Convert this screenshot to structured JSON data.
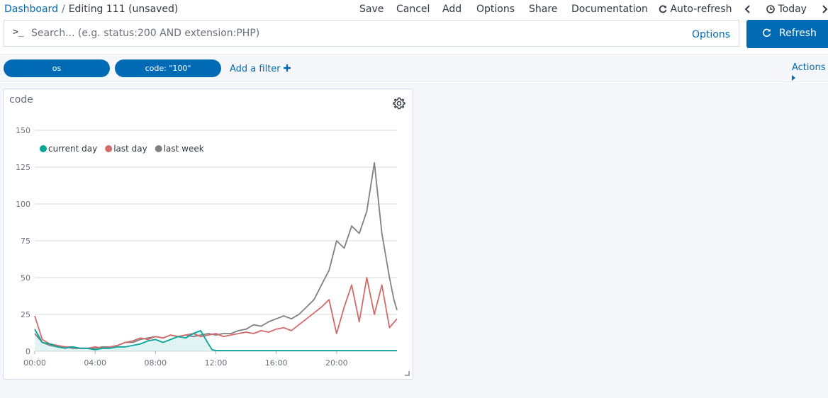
{
  "breadcrumb": {
    "root": "Dashboard",
    "separator": "/",
    "current": "Editing 111 (unsaved)"
  },
  "top_menu": {
    "save": "Save",
    "cancel": "Cancel",
    "add": "Add",
    "options": "Options",
    "share": "Share",
    "documentation": "Documentation",
    "auto_refresh": "Auto-refresh",
    "time_range": "Today"
  },
  "query": {
    "prompt": ">_",
    "placeholder": "Search... (e.g. status:200 AND extension:PHP)",
    "value": "",
    "options_label": "Options",
    "refresh_label": "Refresh"
  },
  "filters": {
    "items": [
      {
        "label": "os"
      },
      {
        "label": "code: \"100\""
      }
    ],
    "add_label": "Add a filter",
    "actions_label": "Actions"
  },
  "panel": {
    "title": "code"
  },
  "colors": {
    "accent": "#006bb4",
    "current_day": "#00a69b",
    "last_day": "#d36a6a",
    "last_week": "#808080"
  },
  "chart_data": {
    "type": "line",
    "title": "",
    "xlabel": "",
    "ylabel": "",
    "xlim": [
      0,
      24
    ],
    "ylim": [
      0,
      150
    ],
    "yticks": [
      0,
      25,
      50,
      75,
      100,
      125,
      150
    ],
    "xticks": [
      "00:00",
      "04:00",
      "08:00",
      "12:00",
      "16:00",
      "20:00"
    ],
    "grid": true,
    "legend_position": "top-left",
    "series": [
      {
        "name": "current day",
        "color": "#00a69b",
        "points": [
          [
            0,
            15
          ],
          [
            0.5,
            6
          ],
          [
            1,
            5
          ],
          [
            1.5,
            3
          ],
          [
            2,
            2
          ],
          [
            2.5,
            3
          ],
          [
            3,
            2
          ],
          [
            3.5,
            2
          ],
          [
            4,
            1
          ],
          [
            4.5,
            2
          ],
          [
            5,
            2
          ],
          [
            5.5,
            3
          ],
          [
            6,
            3
          ],
          [
            6.5,
            4
          ],
          [
            7,
            5
          ],
          [
            7.5,
            7
          ],
          [
            8,
            8
          ],
          [
            8.5,
            6
          ],
          [
            9,
            8
          ],
          [
            9.5,
            10
          ],
          [
            10,
            9
          ],
          [
            10.5,
            12
          ],
          [
            11,
            14
          ],
          [
            11.5,
            5
          ],
          [
            11.75,
            1
          ],
          [
            12,
            0.5
          ],
          [
            14,
            0.5
          ],
          [
            16,
            0.5
          ],
          [
            18,
            0.5
          ],
          [
            20,
            0.5
          ],
          [
            22,
            0.5
          ],
          [
            24,
            0.5
          ]
        ]
      },
      {
        "name": "last day",
        "color": "#d36a6a",
        "points": [
          [
            0,
            24
          ],
          [
            0.5,
            8
          ],
          [
            1,
            5
          ],
          [
            1.5,
            4
          ],
          [
            2,
            3
          ],
          [
            2.5,
            3
          ],
          [
            3,
            2
          ],
          [
            3.5,
            2
          ],
          [
            4,
            3
          ],
          [
            4.5,
            2
          ],
          [
            5,
            3
          ],
          [
            5.5,
            4
          ],
          [
            6,
            6
          ],
          [
            6.5,
            7
          ],
          [
            7,
            9
          ],
          [
            7.5,
            8
          ],
          [
            8,
            10
          ],
          [
            8.5,
            9
          ],
          [
            9,
            11
          ],
          [
            9.5,
            10
          ],
          [
            10,
            11
          ],
          [
            10.5,
            12
          ],
          [
            11,
            10
          ],
          [
            11.5,
            11
          ],
          [
            12,
            12
          ],
          [
            12.5,
            10
          ],
          [
            13,
            11
          ],
          [
            13.5,
            12
          ],
          [
            14,
            13
          ],
          [
            14.5,
            12
          ],
          [
            15,
            14
          ],
          [
            15.5,
            13
          ],
          [
            16,
            15
          ],
          [
            16.5,
            16
          ],
          [
            17,
            14
          ],
          [
            17.5,
            18
          ],
          [
            18,
            22
          ],
          [
            18.5,
            26
          ],
          [
            19,
            30
          ],
          [
            19.5,
            35
          ],
          [
            20,
            12
          ],
          [
            20.5,
            30
          ],
          [
            21,
            45
          ],
          [
            21.5,
            20
          ],
          [
            22,
            50
          ],
          [
            22.5,
            25
          ],
          [
            23,
            45
          ],
          [
            23.5,
            16
          ],
          [
            24,
            22
          ]
        ]
      },
      {
        "name": "last week",
        "color": "#808080",
        "points": [
          [
            0,
            12
          ],
          [
            0.5,
            6
          ],
          [
            1,
            4
          ],
          [
            1.5,
            3
          ],
          [
            2,
            3
          ],
          [
            2.5,
            2
          ],
          [
            3,
            2
          ],
          [
            3.5,
            2
          ],
          [
            4,
            2
          ],
          [
            4.5,
            3
          ],
          [
            5,
            3
          ],
          [
            5.5,
            4
          ],
          [
            6,
            6
          ],
          [
            6.5,
            6
          ],
          [
            7,
            8
          ],
          [
            7.5,
            9
          ],
          [
            8,
            10
          ],
          [
            8.5,
            9
          ],
          [
            9,
            11
          ],
          [
            9.5,
            10
          ],
          [
            10,
            11
          ],
          [
            10.5,
            10
          ],
          [
            11,
            11
          ],
          [
            11.5,
            12
          ],
          [
            12,
            11
          ],
          [
            12.5,
            12
          ],
          [
            13,
            12
          ],
          [
            13.5,
            14
          ],
          [
            14,
            15
          ],
          [
            14.5,
            18
          ],
          [
            15,
            17
          ],
          [
            15.5,
            20
          ],
          [
            16,
            22
          ],
          [
            16.5,
            24
          ],
          [
            17,
            22
          ],
          [
            17.5,
            25
          ],
          [
            18,
            30
          ],
          [
            18.5,
            35
          ],
          [
            19,
            45
          ],
          [
            19.5,
            55
          ],
          [
            20,
            75
          ],
          [
            20.5,
            70
          ],
          [
            21,
            85
          ],
          [
            21.5,
            80
          ],
          [
            22,
            95
          ],
          [
            22.5,
            128
          ],
          [
            23,
            80
          ],
          [
            23.5,
            50
          ],
          [
            23.8,
            35
          ],
          [
            24,
            28
          ]
        ]
      }
    ]
  }
}
